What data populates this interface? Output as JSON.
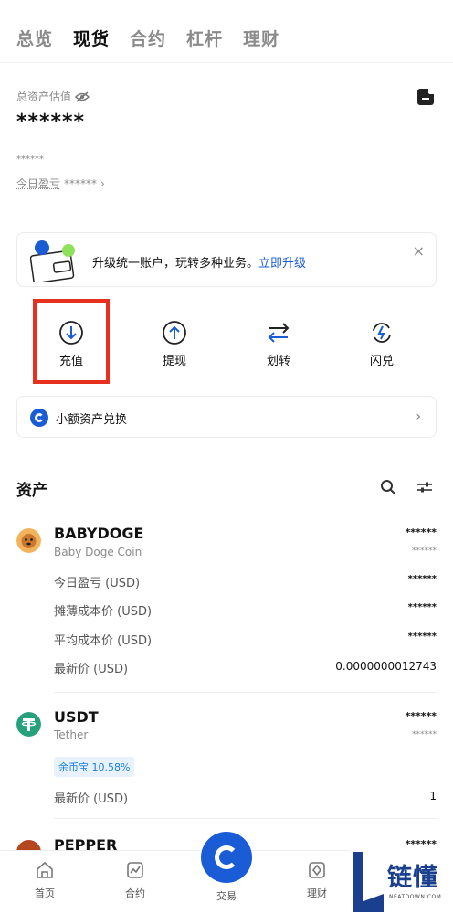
{
  "tabs": [
    {
      "label": "总览",
      "active": false
    },
    {
      "label": "现货",
      "active": true
    },
    {
      "label": "合约",
      "active": false
    },
    {
      "label": "杠杆",
      "active": false
    },
    {
      "label": "理财",
      "active": false
    }
  ],
  "summary": {
    "total_label": "总资产估值",
    "total_value": "******",
    "sub_value": "******",
    "pnl_label": "今日盈亏",
    "pnl_value": "******"
  },
  "banner": {
    "text": "升级统一账户，玩转多种业务。",
    "link": "立即升级",
    "close": "×"
  },
  "actions": [
    {
      "label": "充值",
      "icon": "deposit-icon"
    },
    {
      "label": "提现",
      "icon": "withdraw-icon"
    },
    {
      "label": "划转",
      "icon": "transfer-icon"
    },
    {
      "label": "闪兑",
      "icon": "flash-swap-icon"
    }
  ],
  "small_swap": {
    "label": "小额资产兑换"
  },
  "assets_title": "资产",
  "coins": [
    {
      "symbol": "BABYDOGE",
      "name": "Baby Doge Coin",
      "value": "******",
      "sub": "******",
      "rows": [
        {
          "label": "今日盈亏 (USD)",
          "value": "******"
        },
        {
          "label": "摊薄成本价 (USD)",
          "value": "******"
        },
        {
          "label": "平均成本价 (USD)",
          "value": "******"
        },
        {
          "label": "最新价 (USD)",
          "value": "0.0000000012743"
        }
      ]
    },
    {
      "symbol": "USDT",
      "name": "Tether",
      "value": "******",
      "sub": "******",
      "badge": "余币宝 10.58%",
      "rows": [
        {
          "label": "最新价 (USD)",
          "value": "1"
        }
      ]
    },
    {
      "symbol": "PEPPER",
      "value": "******"
    }
  ],
  "bottom_nav": [
    {
      "label": "首页",
      "icon": "home-icon"
    },
    {
      "label": "合约",
      "icon": "chart-icon"
    },
    {
      "label": "交易",
      "icon": "trade-icon"
    },
    {
      "label": "理财",
      "icon": "finance-icon"
    }
  ],
  "watermark": {
    "title": "链懂",
    "sub": "NEATDOWN.COM"
  },
  "colors": {
    "accent": "#1a5cd6",
    "highlight_box": "#e6311f",
    "usdt": "#26a17b"
  }
}
